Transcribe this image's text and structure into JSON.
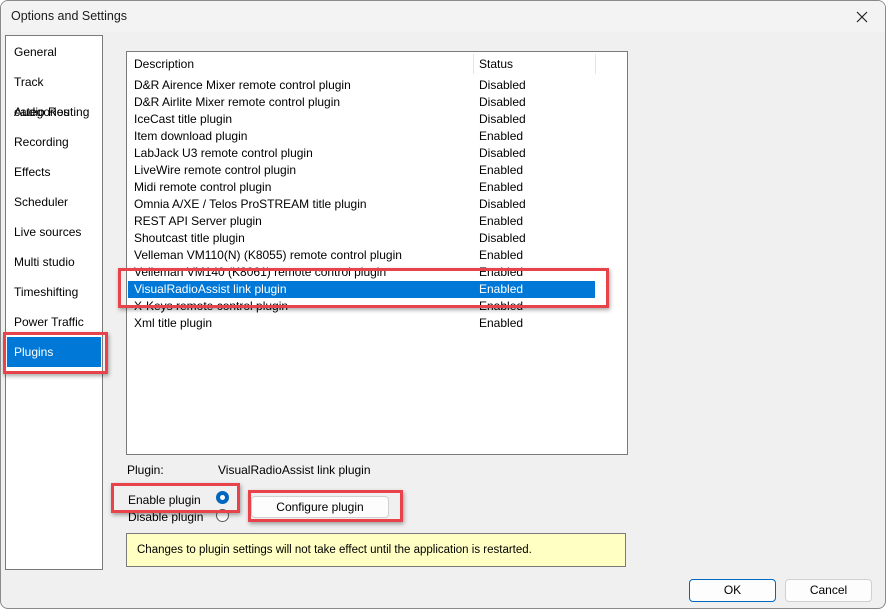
{
  "window": {
    "title": "Options and Settings",
    "close_icon": "close-icon"
  },
  "sidebar": {
    "items": [
      {
        "label": "General"
      },
      {
        "label": "Track categories"
      },
      {
        "label": "Audio Routing"
      },
      {
        "label": "Recording"
      },
      {
        "label": "Effects"
      },
      {
        "label": "Scheduler"
      },
      {
        "label": "Live sources"
      },
      {
        "label": "Multi studio"
      },
      {
        "label": "Timeshifting"
      },
      {
        "label": "Power Traffic"
      },
      {
        "label": "Plugins",
        "selected": true
      }
    ]
  },
  "plugins": {
    "columns": {
      "description": "Description",
      "status": "Status"
    },
    "rows": [
      {
        "description": "D&R Airence Mixer remote control plugin",
        "status": "Disabled"
      },
      {
        "description": "D&R Airlite Mixer remote control plugin",
        "status": "Disabled"
      },
      {
        "description": "IceCast title plugin",
        "status": "Disabled"
      },
      {
        "description": "Item download plugin",
        "status": "Enabled"
      },
      {
        "description": "LabJack U3 remote control plugin",
        "status": "Disabled"
      },
      {
        "description": "LiveWire remote control plugin",
        "status": "Enabled"
      },
      {
        "description": "Midi remote control plugin",
        "status": "Enabled"
      },
      {
        "description": "Omnia A/XE / Telos ProSTREAM title plugin",
        "status": "Disabled"
      },
      {
        "description": "REST API Server plugin",
        "status": "Enabled"
      },
      {
        "description": "Shoutcast title plugin",
        "status": "Disabled"
      },
      {
        "description": "Velleman VM110(N) (K8055) remote control plugin",
        "status": "Enabled"
      },
      {
        "description": "Velleman VM140 (K8061) remote control plugin",
        "status": "Enabled"
      },
      {
        "description": "VisualRadioAssist link plugin",
        "status": "Enabled",
        "selected": true
      },
      {
        "description": "X-Keys remote control plugin",
        "status": "Enabled"
      },
      {
        "description": "Xml title plugin",
        "status": "Enabled"
      }
    ],
    "selected_label": "Plugin:",
    "selected_name": "VisualRadioAssist link plugin",
    "enable_label": "Enable plugin",
    "disable_label": "Disable plugin",
    "enabled": true,
    "configure_label": "Configure plugin",
    "notice": "Changes to plugin settings will not take effect until the application is restarted."
  },
  "footer": {
    "ok_label": "OK",
    "cancel_label": "Cancel"
  },
  "colors": {
    "selection": "#0078d7",
    "highlight_box": "#e8434a",
    "notice_bg": "#ffffc4"
  }
}
